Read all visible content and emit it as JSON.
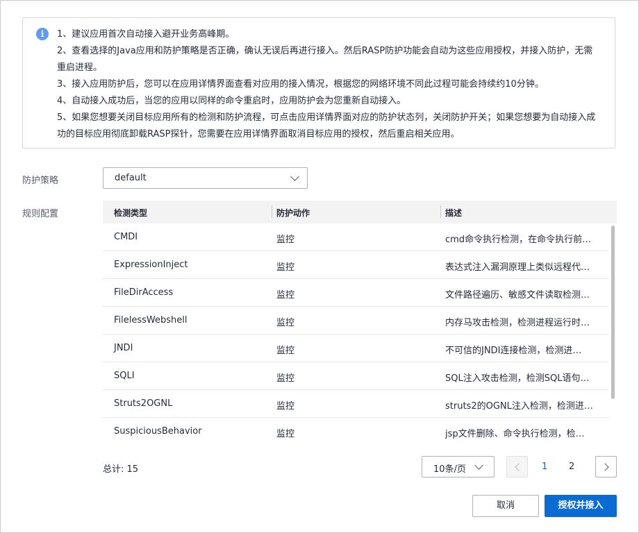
{
  "notice": {
    "lines": [
      "1、建议应用首次自动接入避开业务高峰期。",
      "2、查看选择的Java应用和防护策略是否正确，确认无误后再进行接入。然后RASP防护功能会自动为这些应用授权，并接入防护，无需重启进程。",
      "3、接入应用防护后，您可以在应用详情界面查看对应用的接入情况，根据您的网络环境不同此过程可能会持续约10分钟。",
      "4、自动接入成功后，当您的应用以同样的命令重启时，应用防护会为您重新自动接入。",
      "5、如果您想要关闭目标应用所有的检测和防护流程，可点击应用详情界面对应的防护状态列，关闭防护开关；如果您想要为自动接入成功的目标应用彻底卸载RASP探针，您需要在应用详情界面取消目标应用的授权，然后重启相关应用。"
    ]
  },
  "form": {
    "policy_label": "防护策略",
    "policy_value": "default",
    "rules_label": "规则配置"
  },
  "table": {
    "headers": [
      "检测类型",
      "防护动作",
      "描述"
    ],
    "rows": [
      {
        "type": "CMDI",
        "action": "监控",
        "desc": "cmd命令执行检测，在命令执行前…"
      },
      {
        "type": "ExpressionInject",
        "action": "监控",
        "desc": "表达式注入漏洞原理上类似远程代…"
      },
      {
        "type": "FileDirAccess",
        "action": "监控",
        "desc": "文件路径遍历、敏感文件读取检测…"
      },
      {
        "type": "FilelessWebshell",
        "action": "监控",
        "desc": "内存马攻击检测，检测进程运行时…"
      },
      {
        "type": "JNDI",
        "action": "监控",
        "desc": "不可信的JNDI连接检测，检测进…"
      },
      {
        "type": "SQLI",
        "action": "监控",
        "desc": "SQL注入攻击检测，检测SQL语句…"
      },
      {
        "type": "Struts2OGNL",
        "action": "监控",
        "desc": "struts2的OGNL注入检测，检测进…"
      },
      {
        "type": "SuspiciousBehavior",
        "action": "监控",
        "desc": "jsp文件删除、命令执行检测，检…"
      }
    ]
  },
  "pagination": {
    "total": "总计: 15",
    "page_size": "10条/页",
    "pages": [
      "1",
      "2"
    ],
    "current_page": "1"
  },
  "buttons": {
    "cancel": "取消",
    "confirm": "授权并接入"
  },
  "colors": {
    "primary": "#0a6cd2",
    "info_icon": "#5e9cf2",
    "active_page": "#0066cc"
  }
}
